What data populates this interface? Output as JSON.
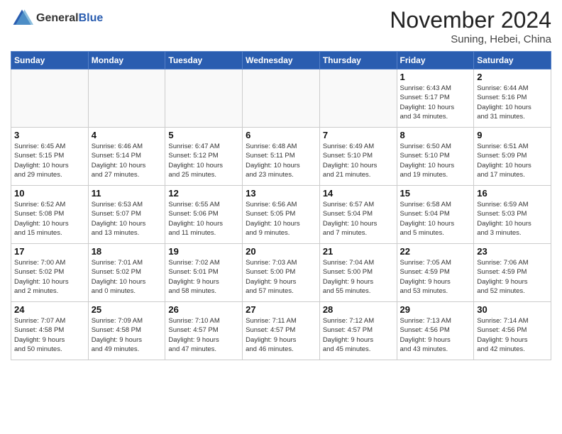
{
  "header": {
    "logo_general": "General",
    "logo_blue": "Blue",
    "month_title": "November 2024",
    "location": "Suning, Hebei, China"
  },
  "days_of_week": [
    "Sunday",
    "Monday",
    "Tuesday",
    "Wednesday",
    "Thursday",
    "Friday",
    "Saturday"
  ],
  "weeks": [
    [
      {
        "day": "",
        "info": ""
      },
      {
        "day": "",
        "info": ""
      },
      {
        "day": "",
        "info": ""
      },
      {
        "day": "",
        "info": ""
      },
      {
        "day": "",
        "info": ""
      },
      {
        "day": "1",
        "info": "Sunrise: 6:43 AM\nSunset: 5:17 PM\nDaylight: 10 hours\nand 34 minutes."
      },
      {
        "day": "2",
        "info": "Sunrise: 6:44 AM\nSunset: 5:16 PM\nDaylight: 10 hours\nand 31 minutes."
      }
    ],
    [
      {
        "day": "3",
        "info": "Sunrise: 6:45 AM\nSunset: 5:15 PM\nDaylight: 10 hours\nand 29 minutes."
      },
      {
        "day": "4",
        "info": "Sunrise: 6:46 AM\nSunset: 5:14 PM\nDaylight: 10 hours\nand 27 minutes."
      },
      {
        "day": "5",
        "info": "Sunrise: 6:47 AM\nSunset: 5:12 PM\nDaylight: 10 hours\nand 25 minutes."
      },
      {
        "day": "6",
        "info": "Sunrise: 6:48 AM\nSunset: 5:11 PM\nDaylight: 10 hours\nand 23 minutes."
      },
      {
        "day": "7",
        "info": "Sunrise: 6:49 AM\nSunset: 5:10 PM\nDaylight: 10 hours\nand 21 minutes."
      },
      {
        "day": "8",
        "info": "Sunrise: 6:50 AM\nSunset: 5:10 PM\nDaylight: 10 hours\nand 19 minutes."
      },
      {
        "day": "9",
        "info": "Sunrise: 6:51 AM\nSunset: 5:09 PM\nDaylight: 10 hours\nand 17 minutes."
      }
    ],
    [
      {
        "day": "10",
        "info": "Sunrise: 6:52 AM\nSunset: 5:08 PM\nDaylight: 10 hours\nand 15 minutes."
      },
      {
        "day": "11",
        "info": "Sunrise: 6:53 AM\nSunset: 5:07 PM\nDaylight: 10 hours\nand 13 minutes."
      },
      {
        "day": "12",
        "info": "Sunrise: 6:55 AM\nSunset: 5:06 PM\nDaylight: 10 hours\nand 11 minutes."
      },
      {
        "day": "13",
        "info": "Sunrise: 6:56 AM\nSunset: 5:05 PM\nDaylight: 10 hours\nand 9 minutes."
      },
      {
        "day": "14",
        "info": "Sunrise: 6:57 AM\nSunset: 5:04 PM\nDaylight: 10 hours\nand 7 minutes."
      },
      {
        "day": "15",
        "info": "Sunrise: 6:58 AM\nSunset: 5:04 PM\nDaylight: 10 hours\nand 5 minutes."
      },
      {
        "day": "16",
        "info": "Sunrise: 6:59 AM\nSunset: 5:03 PM\nDaylight: 10 hours\nand 3 minutes."
      }
    ],
    [
      {
        "day": "17",
        "info": "Sunrise: 7:00 AM\nSunset: 5:02 PM\nDaylight: 10 hours\nand 2 minutes."
      },
      {
        "day": "18",
        "info": "Sunrise: 7:01 AM\nSunset: 5:02 PM\nDaylight: 10 hours\nand 0 minutes."
      },
      {
        "day": "19",
        "info": "Sunrise: 7:02 AM\nSunset: 5:01 PM\nDaylight: 9 hours\nand 58 minutes."
      },
      {
        "day": "20",
        "info": "Sunrise: 7:03 AM\nSunset: 5:00 PM\nDaylight: 9 hours\nand 57 minutes."
      },
      {
        "day": "21",
        "info": "Sunrise: 7:04 AM\nSunset: 5:00 PM\nDaylight: 9 hours\nand 55 minutes."
      },
      {
        "day": "22",
        "info": "Sunrise: 7:05 AM\nSunset: 4:59 PM\nDaylight: 9 hours\nand 53 minutes."
      },
      {
        "day": "23",
        "info": "Sunrise: 7:06 AM\nSunset: 4:59 PM\nDaylight: 9 hours\nand 52 minutes."
      }
    ],
    [
      {
        "day": "24",
        "info": "Sunrise: 7:07 AM\nSunset: 4:58 PM\nDaylight: 9 hours\nand 50 minutes."
      },
      {
        "day": "25",
        "info": "Sunrise: 7:09 AM\nSunset: 4:58 PM\nDaylight: 9 hours\nand 49 minutes."
      },
      {
        "day": "26",
        "info": "Sunrise: 7:10 AM\nSunset: 4:57 PM\nDaylight: 9 hours\nand 47 minutes."
      },
      {
        "day": "27",
        "info": "Sunrise: 7:11 AM\nSunset: 4:57 PM\nDaylight: 9 hours\nand 46 minutes."
      },
      {
        "day": "28",
        "info": "Sunrise: 7:12 AM\nSunset: 4:57 PM\nDaylight: 9 hours\nand 45 minutes."
      },
      {
        "day": "29",
        "info": "Sunrise: 7:13 AM\nSunset: 4:56 PM\nDaylight: 9 hours\nand 43 minutes."
      },
      {
        "day": "30",
        "info": "Sunrise: 7:14 AM\nSunset: 4:56 PM\nDaylight: 9 hours\nand 42 minutes."
      }
    ]
  ]
}
